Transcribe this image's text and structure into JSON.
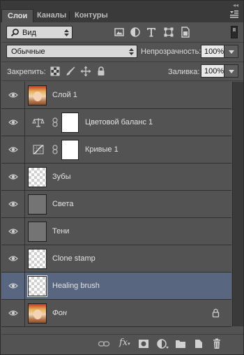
{
  "tabs": [
    {
      "label": "Слои"
    },
    {
      "label": "Каналы"
    },
    {
      "label": "Контуры"
    }
  ],
  "filter": {
    "kind_label": "Вид",
    "icons": [
      "image-filter-icon",
      "adjustment-filter-icon",
      "type-filter-icon",
      "shape-filter-icon",
      "smart-object-filter-icon"
    ]
  },
  "blend": {
    "mode": "Обычные",
    "opacity_label": "Непрозрачность:",
    "opacity_value": "100%"
  },
  "lock": {
    "label": "Закрепить:",
    "icons": [
      "lock-transparent-pixels-icon",
      "lock-image-pixels-icon",
      "lock-position-icon",
      "lock-all-icon"
    ],
    "fill_label": "Заливка:",
    "fill_value": "100%"
  },
  "layers": [
    {
      "name": "Слой 1",
      "thumb": "photo"
    },
    {
      "name": "Цветовой баланс 1",
      "thumb": "color-balance-icon"
    },
    {
      "name": "Кривые 1",
      "thumb": "curves-icon"
    },
    {
      "name": "Зубы",
      "thumb": "transparent"
    },
    {
      "name": "Света",
      "thumb": "grey"
    },
    {
      "name": "Тени",
      "thumb": "grey"
    },
    {
      "name": "Clone stamp",
      "thumb": "transparent"
    },
    {
      "name": "Healing brush",
      "thumb": "transparent",
      "selected": true
    },
    {
      "name": "Фон",
      "thumb": "photo",
      "locked": true
    }
  ],
  "bottom_toolbar": {
    "fx_label": "fx",
    "icons": [
      "link-layers-icon",
      "layer-style-icon",
      "add-mask-icon",
      "new-adjustment-icon",
      "new-group-icon",
      "new-layer-icon",
      "delete-layer-icon"
    ]
  },
  "colors": {
    "panel_bg": "#535353",
    "selected_row": "#596680",
    "tabbar_bg": "#3a3a3a"
  }
}
